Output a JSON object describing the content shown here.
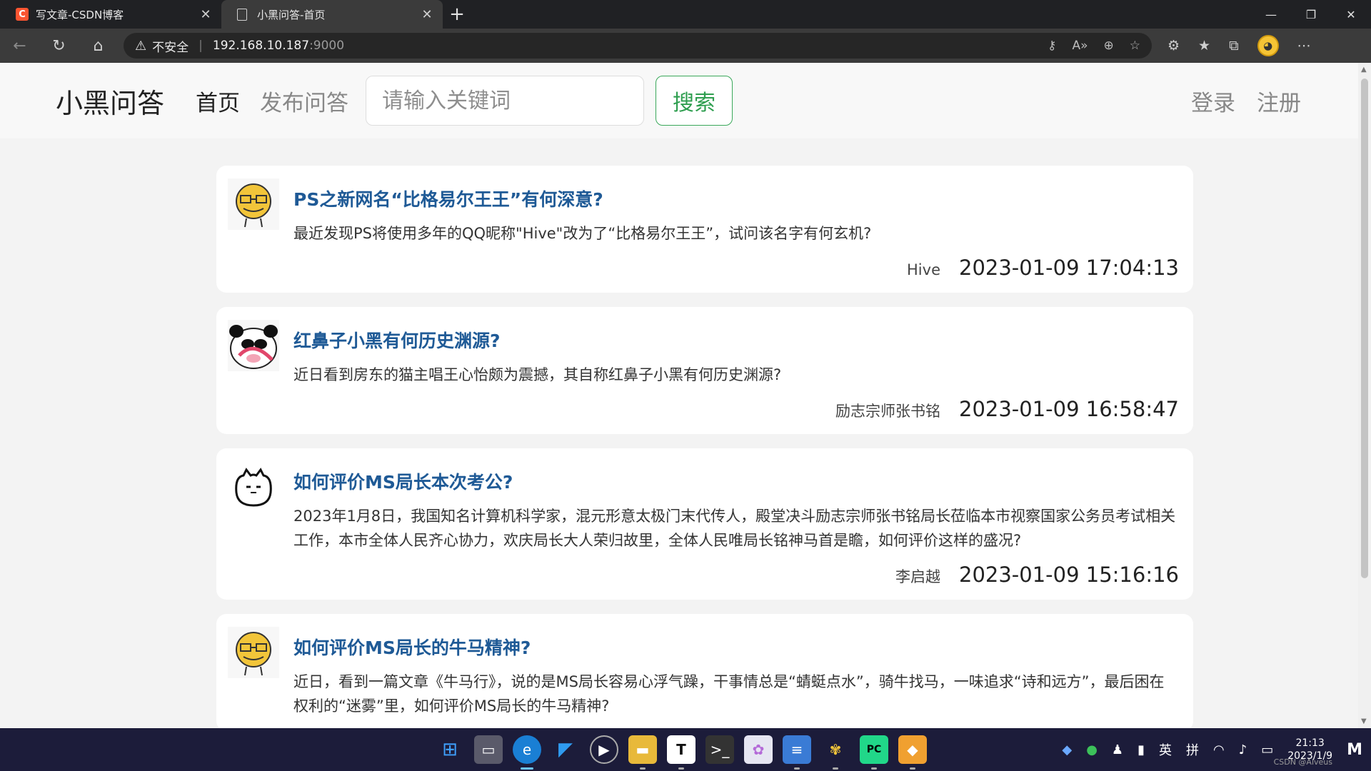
{
  "browser": {
    "tabs": [
      {
        "title": "写文章-CSDN博客",
        "active": false
      },
      {
        "title": "小黑问答-首页",
        "active": true
      }
    ],
    "address": {
      "security": "不安全",
      "host": "192.168.10.187",
      "port": ":9000"
    }
  },
  "header": {
    "brand": "小黑问答",
    "nav_home": "首页",
    "nav_publish": "发布问答",
    "search_placeholder": "请输入关键词",
    "search_button": "搜索",
    "login": "登录",
    "register": "注册"
  },
  "questions": [
    {
      "title": "PS之新网名“比格易尔王王”有何深意?",
      "content": "最近发现PS将使用多年的QQ昵称\"Hive\"改为了“比格易尔王王”，试问该名字有何玄机?",
      "author": "Hive",
      "time": "2023-01-09 17:04:13"
    },
    {
      "title": "红鼻子小黑有何历史渊源?",
      "content": "近日看到房东的猫主唱王心怡颇为震撼，其自称红鼻子小黑有何历史渊源?",
      "author": "励志宗师张书铭",
      "time": "2023-01-09 16:58:47"
    },
    {
      "title": "如何评价MS局长本次考公?",
      "content": "2023年1月8日，我国知名计算机科学家，混元形意太极门末代传人，殿堂决斗励志宗师张书铭局长莅临本市视察国家公务员考试相关工作，本市全体人民齐心协力，欢庆局长大人荣归故里，全体人民唯局长铭神马首是瞻，如何评价这样的盛况?",
      "author": "李启越",
      "time": "2023-01-09 15:16:16"
    },
    {
      "title": "如何评价MS局长的牛马精神?",
      "content": "近日，看到一篇文章《牛马行》，说的是MS局长容易心浮气躁，干事情总是“蜻蜓点水”，骑牛找马，一味追求“诗和远方”，最后困在权利的“迷雾”里，如何评价MS局长的牛马精神?",
      "author": "",
      "time": ""
    }
  ],
  "taskbar": {
    "lang1": "英",
    "lang2": "拼",
    "time": "21:13",
    "date": "2023/1/9",
    "watermark": "CSDN @Alveus"
  }
}
